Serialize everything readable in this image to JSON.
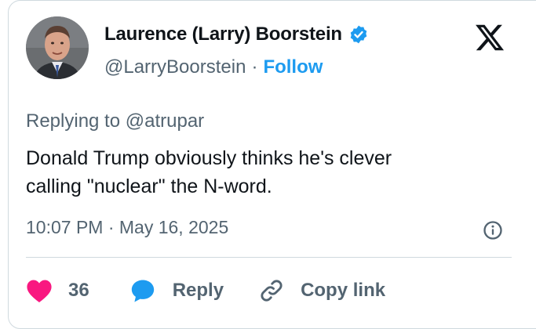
{
  "author": {
    "display_name": "Laurence (Larry) Boorstein",
    "handle": "@LarryBoorstein",
    "separator": "·",
    "follow_label": "Follow"
  },
  "icons": {
    "verified": "verified-badge-icon",
    "logo": "x-logo-icon",
    "info": "info-icon",
    "like": "heart-icon",
    "reply": "speech-bubble-icon",
    "copy": "link-icon"
  },
  "reply_context": {
    "prefix": "Replying to",
    "mention": "@atrupar"
  },
  "tweet": {
    "text_line1": "Donald Trump obviously thinks he's clever",
    "text_line2": "calling \"nuclear\" the N-word.",
    "timestamp": "10:07 PM · May 16, 2025"
  },
  "actions": {
    "like_count": "36",
    "reply_label": "Reply",
    "copy_label": "Copy link"
  },
  "colors": {
    "accent": "#1d9bf0",
    "like": "#f91880",
    "text": "#0f1419",
    "muted": "#536471",
    "border": "#cfd9de"
  }
}
